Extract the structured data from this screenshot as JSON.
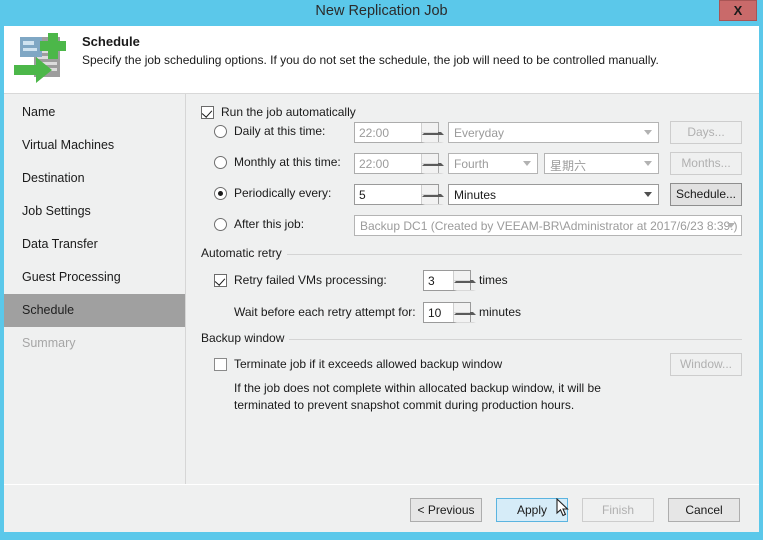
{
  "window": {
    "title": "New Replication Job",
    "close_label": "X",
    "titlebar_color": "#5bc8ea"
  },
  "header": {
    "icon": "replication-job-icon",
    "title": "Schedule",
    "subtitle": "Specify the job scheduling options. If you do not set the schedule, the job will need to be controlled manually."
  },
  "sidebar": {
    "items": [
      {
        "label": "Name",
        "state": "normal"
      },
      {
        "label": "Virtual Machines",
        "state": "normal"
      },
      {
        "label": "Destination",
        "state": "normal"
      },
      {
        "label": "Job Settings",
        "state": "normal"
      },
      {
        "label": "Data Transfer",
        "state": "normal"
      },
      {
        "label": "Guest Processing",
        "state": "normal"
      },
      {
        "label": "Schedule",
        "state": "selected"
      },
      {
        "label": "Summary",
        "state": "disabled"
      }
    ]
  },
  "main": {
    "run_automatically": {
      "label": "Run the job automatically",
      "checked": true
    },
    "schedule_modes": {
      "daily": {
        "label": "Daily at this time:",
        "selected": false,
        "time": "22:00",
        "period": "Everyday",
        "button": "Days..."
      },
      "monthly": {
        "label": "Monthly at this time:",
        "selected": false,
        "time": "22:00",
        "ordinal": "Fourth",
        "weekday": "星期六",
        "button": "Months..."
      },
      "periodically": {
        "label": "Periodically every:",
        "selected": true,
        "interval": "5",
        "unit": "Minutes",
        "button": "Schedule..."
      },
      "after_job": {
        "label": "After this job:",
        "selected": false,
        "job": "Backup DC1 (Created by VEEAM-BR\\Administrator at 2017/6/23 8:39.)"
      }
    },
    "automatic_retry": {
      "group_label": "Automatic retry",
      "retry_checkbox_label": "Retry failed VMs processing:",
      "retry_checked": true,
      "retry_times": "3",
      "retry_times_suffix": "times",
      "wait_label": "Wait before each retry attempt for:",
      "wait_value": "10",
      "wait_suffix": "minutes"
    },
    "backup_window": {
      "group_label": "Backup window",
      "terminate_label": "Terminate job if it exceeds allowed backup window",
      "terminate_checked": false,
      "window_button": "Window...",
      "description_line1": "If the job does not complete within allocated backup window, it will be",
      "description_line2": "terminated to prevent snapshot commit during production hours."
    }
  },
  "footer": {
    "previous": "< Previous",
    "apply": "Apply",
    "finish": "Finish",
    "cancel": "Cancel"
  }
}
